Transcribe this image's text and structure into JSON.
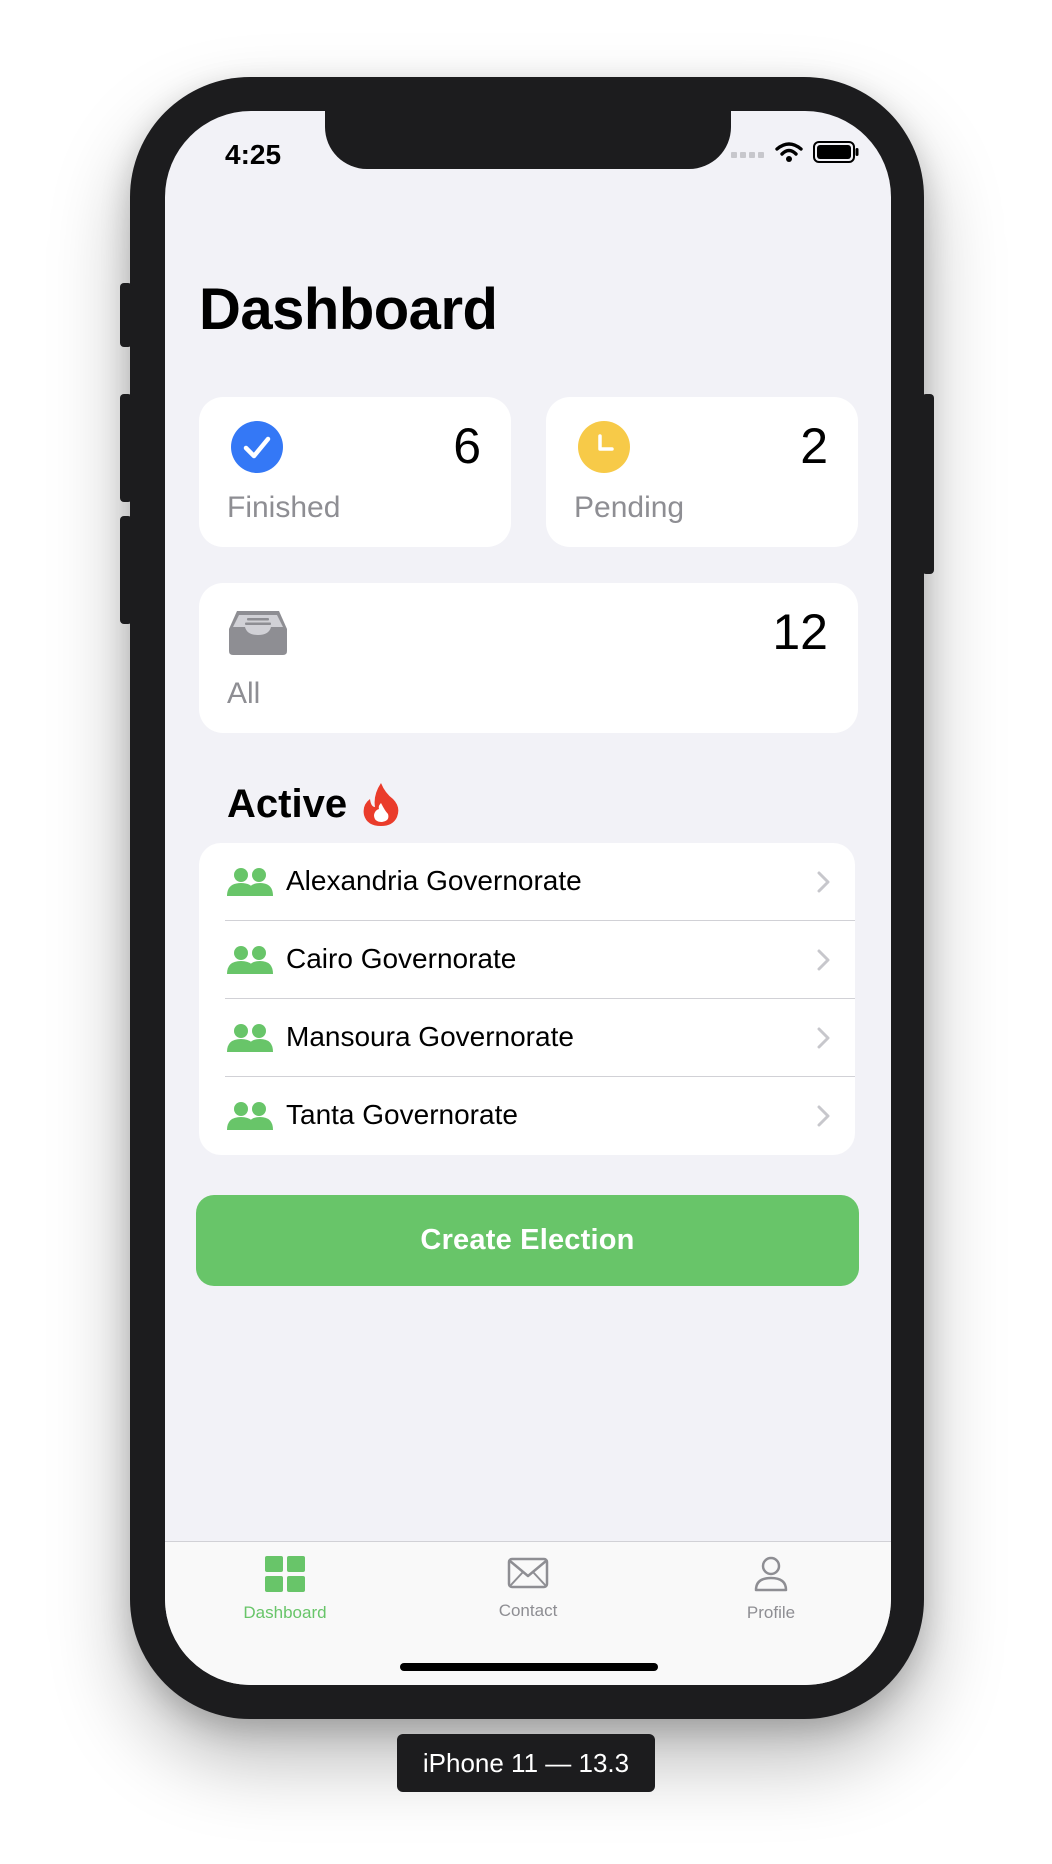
{
  "status_bar": {
    "time": "4:25"
  },
  "page": {
    "title": "Dashboard"
  },
  "stats": {
    "finished": {
      "label": "Finished",
      "count": "6",
      "icon": "checkmark-circle-icon",
      "color": "#3478f6"
    },
    "pending": {
      "label": "Pending",
      "count": "2",
      "icon": "clock-icon",
      "color": "#f7ca48"
    },
    "all": {
      "label": "All",
      "count": "12",
      "icon": "tray-icon",
      "color": "#8e8e93"
    }
  },
  "active_section": {
    "title": "Active",
    "icon": "flame-icon",
    "items": [
      {
        "label": "Alexandria Governorate",
        "icon": "people-icon"
      },
      {
        "label": "Cairo Governorate",
        "icon": "people-icon"
      },
      {
        "label": "Mansoura Governorate",
        "icon": "people-icon"
      },
      {
        "label": "Tanta Governorate",
        "icon": "people-icon"
      }
    ]
  },
  "create_button": {
    "label": "Create Election"
  },
  "tabbar": {
    "tabs": [
      {
        "label": "Dashboard",
        "icon": "grid-icon",
        "active": true
      },
      {
        "label": "Contact",
        "icon": "envelope-icon",
        "active": false
      },
      {
        "label": "Profile",
        "icon": "person-icon",
        "active": false
      }
    ]
  },
  "device_label": "iPhone 11 — 13.3",
  "colors": {
    "accent_green": "#68c569",
    "background": "#f2f2f7",
    "secondary_text": "#8e8e93"
  }
}
